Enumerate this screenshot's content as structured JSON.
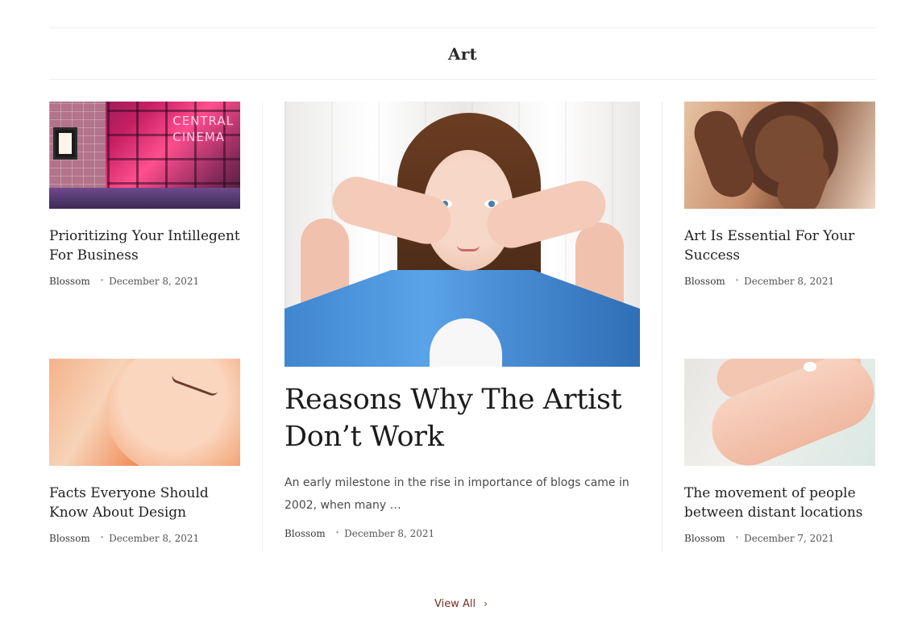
{
  "section": {
    "title": "Art"
  },
  "cards": [
    {
      "title": "Prioritizing Your Intillegent For Business",
      "author": "Blossom",
      "date": "December 8, 2021",
      "sign": "CENTRAL\nCINEMA"
    },
    {
      "title": "Art Is Essential For Your Success",
      "author": "Blossom",
      "date": "December 8, 2021"
    },
    {
      "title": "Facts Everyone Should Know About Design",
      "author": "Blossom",
      "date": "December 8, 2021"
    },
    {
      "title": "The movement of people between distant locations",
      "author": "Blossom",
      "date": "December 7, 2021"
    }
  ],
  "featured": {
    "title": "Reasons Why The Artist Don’t Work",
    "excerpt": "An early milestone in the rise in importance of blogs came in 2002, when many …",
    "author": "Blossom",
    "date": "December 8, 2021"
  },
  "view_all": {
    "label": "View All",
    "icon": "chevron-right-icon"
  },
  "colors": {
    "accent": "#7a2f2a",
    "divider": "#ededed",
    "meta_dot": "#b7a19a"
  }
}
